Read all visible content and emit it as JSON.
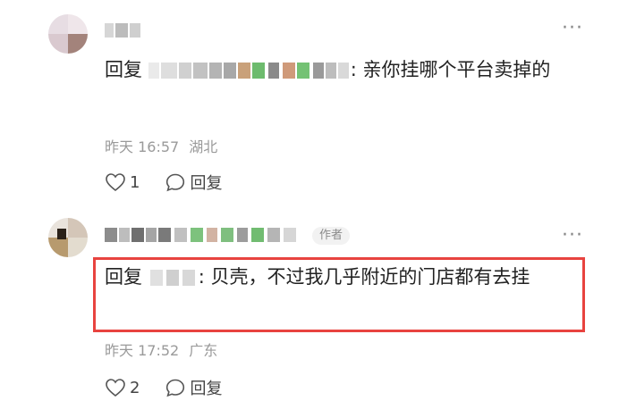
{
  "comments": [
    {
      "reply_prefix": "回复",
      "reply_text": ": 亲你挂哪个平台卖掉的",
      "date": "昨天 16:57",
      "location": "湖北",
      "like_count": "1",
      "reply_label": "回复",
      "more_label": "···"
    },
    {
      "author_tag": "作者",
      "reply_prefix": "回复",
      "reply_text": ": 贝壳，不过我几乎附近的门店都有去挂",
      "date": "昨天 17:52",
      "location": "广东",
      "like_count": "2",
      "reply_label": "回复",
      "more_label": "···"
    }
  ],
  "colors": {
    "highlight_border": "#e8433f",
    "meta_text": "#9a9a9a",
    "body_text": "#222222"
  }
}
